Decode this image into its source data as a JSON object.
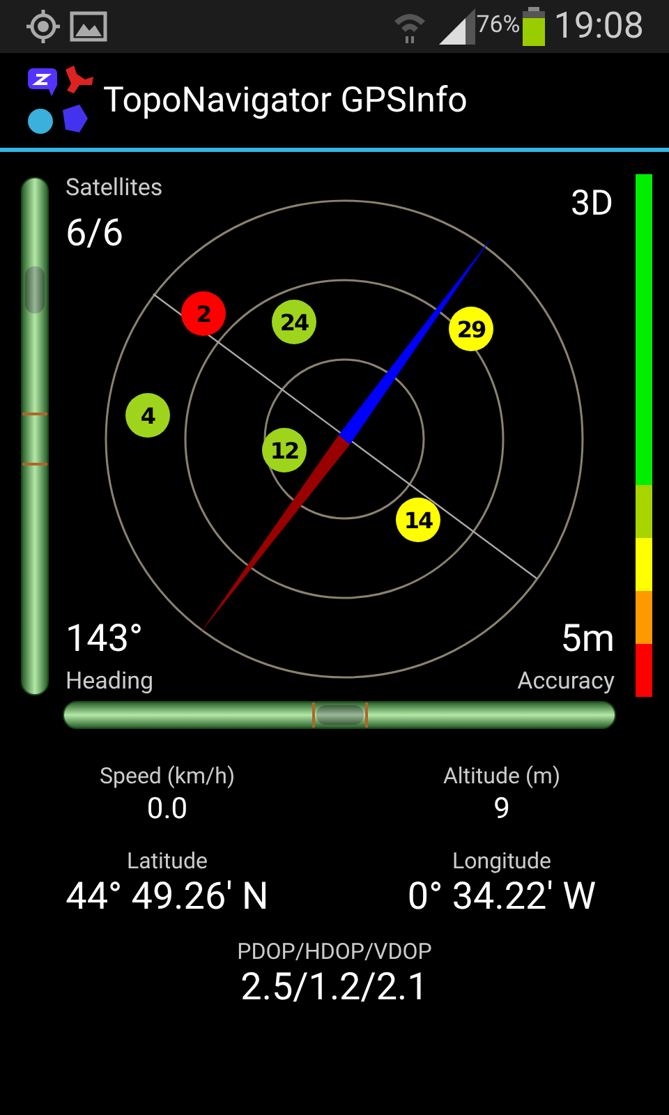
{
  "status_bar": {
    "battery": "76%",
    "time": "19:08"
  },
  "app_bar": {
    "title": "TopoNavigator GPSInfo"
  },
  "sky_plot": {
    "satellites_label": "Satellites",
    "satellites_value": "6/6",
    "fix": "3D",
    "heading_value": "143°",
    "heading_label": "Heading",
    "accuracy_value": "5m",
    "accuracy_label": "Accuracy",
    "satellites": [
      {
        "number": "2",
        "color": "#ff0000"
      },
      {
        "number": "24",
        "color": "#9fd41c"
      },
      {
        "number": "29",
        "color": "#ffff00"
      },
      {
        "number": "4",
        "color": "#9fd41c"
      },
      {
        "number": "12",
        "color": "#9fd41c"
      },
      {
        "number": "14",
        "color": "#ffff00"
      }
    ]
  },
  "tilt_vertical": {
    "level": 0.17
  },
  "tilt_horizontal": {
    "level": 0.5
  },
  "accuracy_scale": [
    {
      "color": "#00ee00"
    },
    {
      "color": "#a8d400"
    },
    {
      "color": "#ffff00"
    },
    {
      "color": "#ff9900"
    },
    {
      "color": "#ff0000"
    }
  ],
  "readings": [
    {
      "label": "Speed (km/h)",
      "value": "0.0",
      "kind": "small"
    },
    {
      "label": "Altitude (m)",
      "value": "9",
      "kind": "small"
    },
    {
      "label": "Latitude",
      "value": "44° 49.26′ N",
      "kind": "large"
    },
    {
      "label": "Longitude",
      "value": "0° 34.22′ W",
      "kind": "large"
    },
    {
      "label": "PDOP/HDOP/VDOP",
      "value": "2.5/1.2/2.1",
      "kind": "wide"
    }
  ]
}
